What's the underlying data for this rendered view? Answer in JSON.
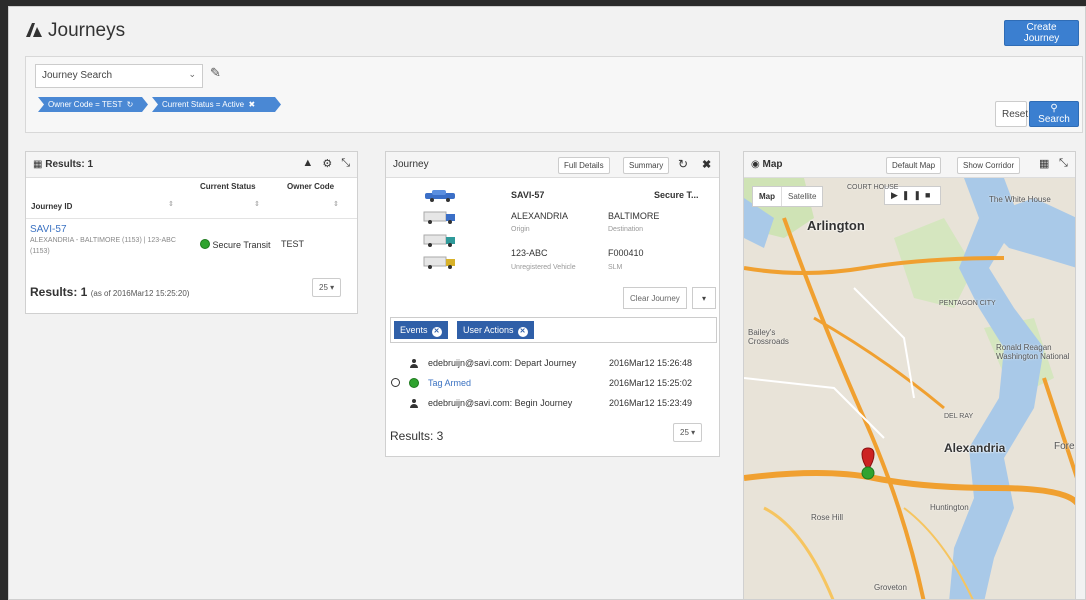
{
  "header": {
    "title": "Journeys",
    "create_button": "Create Journey"
  },
  "search": {
    "select_value": "Journey Search",
    "filters": [
      "Owner Code = TEST",
      "Current Status = Active"
    ],
    "reset_label": "Reset",
    "search_label": "Search"
  },
  "results": {
    "title": "Results: 1",
    "columns": [
      "Journey ID",
      "Current Status",
      "Owner Code"
    ],
    "row": {
      "journey_id": "SAVI-57",
      "route": "ALEXANDRIA - BALTIMORE (1153) | 123-ABC (1153)",
      "status": "Secure Transit",
      "owner_code": "TEST"
    },
    "footer_count": "Results: 1",
    "footer_asof": "(as of 2016Mar12 15:25:20)",
    "page_size": "25"
  },
  "journey": {
    "title": "Journey",
    "full_details": "Full Details",
    "summary": "Summary",
    "id": "SAVI-57",
    "status": "Secure T...",
    "origin": "ALEXANDRIA",
    "origin_label": "Origin",
    "destination": "BALTIMORE",
    "destination_label": "Destination",
    "vehicle": "123-ABC",
    "vehicle_label": "Unregistered Vehicle",
    "slm": "F000410",
    "slm_label": "SLM",
    "clear_button": "Clear Journey",
    "tabs": [
      "Events",
      "User Actions"
    ],
    "events": [
      {
        "text": "edebruijn@savi.com: Depart Journey",
        "time": "2016Mar12 15:26:48"
      },
      {
        "text": "Tag Armed",
        "time": "2016Mar12 15:25:02"
      },
      {
        "text": "edebruijn@savi.com: Begin Journey",
        "time": "2016Mar12 15:23:49"
      }
    ],
    "results_count": "Results: 3",
    "page_size": "25"
  },
  "map": {
    "title": "Map",
    "default_map": "Default Map",
    "show_corridor": "Show Corridor",
    "toggle": [
      "Map",
      "Satellite"
    ],
    "labels": {
      "arlington": "Arlington",
      "alexandria": "Alexandria",
      "white_house": "The White House",
      "baileys": "Bailey's Crossroads",
      "reagan": "Ronald Reagan Washington National",
      "huntington": "Huntington",
      "rose_hill": "Rose Hill",
      "groveton": "Groveton",
      "court_house": "COURT HOUSE",
      "pentagon": "PENTAGON CITY",
      "del_ray": "DEL RAY",
      "forest": "Fores"
    }
  },
  "colors": {
    "primary": "#3b7fd0",
    "chip": "#4a88d4",
    "tab": "#2f5fa8",
    "status_green": "#2fa32f",
    "marker_red": "#cc2222"
  }
}
